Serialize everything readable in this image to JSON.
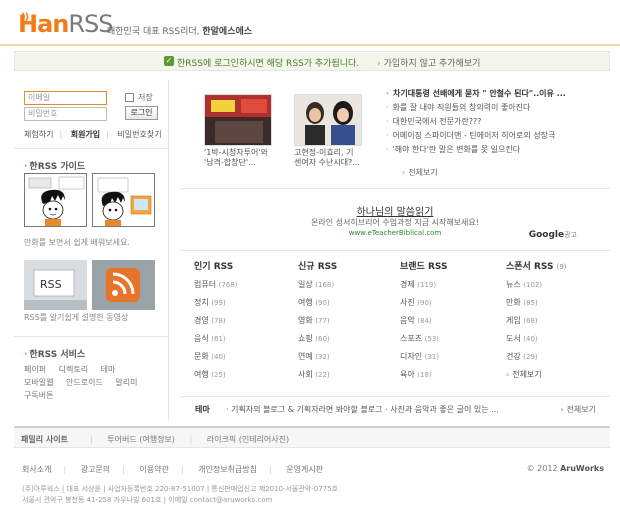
{
  "brand": {
    "logo_han": "Han",
    "logo_rss": "RSS",
    "tagline_prefix": "대한민국 대표 RSS리더, ",
    "tagline_bold": "한알에스에스"
  },
  "notice": {
    "message": "한RSS에 로그인하시면 해당 RSS가 추가됩니다.",
    "skip_link": "가입하지 않고 추가해보기"
  },
  "login": {
    "id_placeholder": "이메일",
    "pw_placeholder": "비밀번호",
    "save_label": "저장",
    "login_button": "로그인",
    "links": [
      "체험하기",
      "회원가입",
      "비밀번호찾기"
    ]
  },
  "guide": {
    "title": "한RSS 가이드",
    "cartoon_caption": "만화를 보면서 쉽게 배워보세요.",
    "video_caption": "RSS를 알기쉽게 설명한 동영상"
  },
  "services": {
    "title": "한RSS 서비스",
    "items": [
      "페이퍼",
      "디렉토리",
      "테마",
      "모바일웹",
      "안드로이드",
      "알리미",
      "구독버튼"
    ]
  },
  "photos": [
    {
      "caption_line1": "'1박-시청자투어'와",
      "caption_line2": "'남격-합창단'..."
    },
    {
      "caption_line1": "고현정-이효리, 기",
      "caption_line2": "센여자 수난시대?..."
    }
  ],
  "news": {
    "items": [
      {
        "text": "차기대통령 선배에게 묻자 \" 안철수 된다\"..이유 ...",
        "bold": true
      },
      {
        "text": "화를 잘 내야 직원들의 창의력이 좋아진다",
        "bold": false
      },
      {
        "text": "대한민국에서 전문가란???",
        "bold": false
      },
      {
        "text": "어메이징 스파이더맨 - 틴에이저 히어로의 성장극",
        "bold": false
      },
      {
        "text": "'해야 한다'란 말은 변화를 못 일으킨다",
        "bold": false
      }
    ],
    "more_label": "전체보기"
  },
  "ad": {
    "title": "하나님의 말씀읽기",
    "description": "온라인 성서히브리어 수업과정 지금 시작해보세요!",
    "url": "www.eTeacherBiblical.com",
    "google_label": "Google",
    "google_suffix": "광고"
  },
  "rss_columns": [
    {
      "title": "인기 RSS",
      "title_count": "",
      "items": [
        {
          "name": "컴퓨터",
          "count": "(768)"
        },
        {
          "name": "정치",
          "count": "(99)"
        },
        {
          "name": "경영",
          "count": "(78)"
        },
        {
          "name": "음식",
          "count": "(61)"
        },
        {
          "name": "문화",
          "count": "(40)"
        },
        {
          "name": "여행",
          "count": "(25)"
        }
      ],
      "more": ""
    },
    {
      "title": "신규 RSS",
      "title_count": "",
      "items": [
        {
          "name": "일상",
          "count": "(168)"
        },
        {
          "name": "여행",
          "count": "(90)"
        },
        {
          "name": "영화",
          "count": "(77)"
        },
        {
          "name": "쇼핑",
          "count": "(60)"
        },
        {
          "name": "연예",
          "count": "(32)"
        },
        {
          "name": "사회",
          "count": "(22)"
        }
      ],
      "more": ""
    },
    {
      "title": "브랜드 RSS",
      "title_count": "",
      "items": [
        {
          "name": "경제",
          "count": "(119)"
        },
        {
          "name": "사진",
          "count": "(90)"
        },
        {
          "name": "음악",
          "count": "(84)"
        },
        {
          "name": "스포츠",
          "count": "(53)"
        },
        {
          "name": "디자인",
          "count": "(31)"
        },
        {
          "name": "육아",
          "count": "(18)"
        }
      ],
      "more": ""
    },
    {
      "title": "스폰서 RSS",
      "title_count": "(9)",
      "items": [
        {
          "name": "뉴스",
          "count": "(102)"
        },
        {
          "name": "만화",
          "count": "(85)"
        },
        {
          "name": "게임",
          "count": "(68)"
        },
        {
          "name": "도서",
          "count": "(40)"
        },
        {
          "name": "건강",
          "count": "(29)"
        }
      ],
      "more": "전체보기"
    }
  ],
  "theme": {
    "label": "테마",
    "items": "· 기획자의 블로그 & 기획자라면 봐야할 블로그  · 사진과 음악과 좋은 글이 있는 ...",
    "more": "전체보기"
  },
  "family": {
    "label": "패밀리 사이트",
    "links": [
      "투어버드 (여행정보)",
      "라이크픽 (인테리어사진)"
    ]
  },
  "footer": {
    "links": [
      "회사소개",
      "광고문의",
      "이용약관",
      "개인정보취급방침",
      "운영게시판"
    ],
    "copyright_prefix": "© 2012 ",
    "copyright_company": "AruWorks",
    "address_line1": "(주)아루웍스  |  대표 서상윤  |  사업자등록번호 220-87-51007  |  통신판매업신고 제2010-서울관악-0775호",
    "address_line2": "서울시 관악구 봉천동 41-258 카우나빌 601호  |  이메일 contact@aruworks.com"
  },
  "colors": {
    "accent": "#f07d1a",
    "notice_green": "#4a7d1f"
  }
}
